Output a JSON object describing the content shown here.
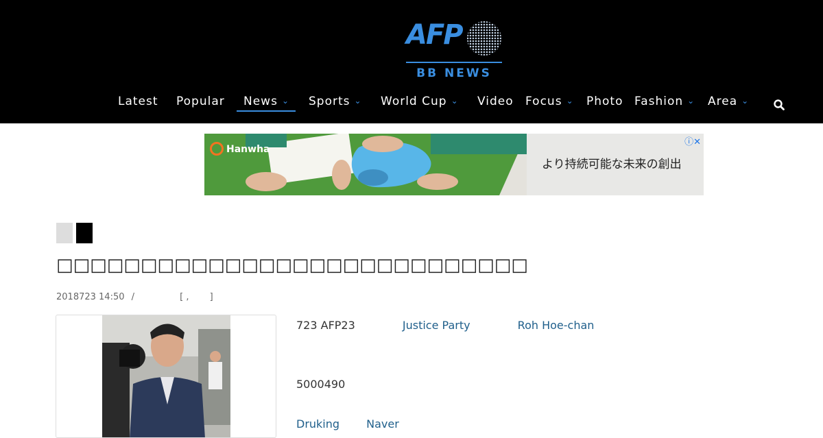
{
  "header": {
    "logo_text": "AFP",
    "logo_sub": "BB NEWS"
  },
  "nav": {
    "items": [
      {
        "label": "Latest",
        "has_dropdown": false
      },
      {
        "label": "Popular",
        "has_dropdown": false
      },
      {
        "label": "News",
        "has_dropdown": true,
        "active": true
      },
      {
        "label": "Sports",
        "has_dropdown": true
      },
      {
        "label": "World Cup",
        "has_dropdown": true
      },
      {
        "label": "Video",
        "has_dropdown": false
      },
      {
        "label": "Focus",
        "has_dropdown": true
      },
      {
        "label": "Photo",
        "has_dropdown": false
      },
      {
        "label": "Fashion",
        "has_dropdown": true
      },
      {
        "label": "Area",
        "has_dropdown": true
      }
    ],
    "chevron": "⌄",
    "search_icon": "search-icon"
  },
  "ad": {
    "brand": "Hanwha",
    "text": "より持続可能な未来の創出",
    "controls": "ⓘ✕"
  },
  "article": {
    "title": "□□□□□□□□□□□□□□□□□□□□□□□□□□□□",
    "date": "2018723 14:50",
    "separator": "/",
    "bracket_open": "[ ,",
    "bracket_close": "]",
    "line1_prefix": "723 AFP23",
    "link1": "Justice Party",
    "link2": "Roh Hoe-chan",
    "line2": "5000490",
    "link3": "Druking",
    "link4": "Naver"
  },
  "colors": {
    "header_bg": "#000000",
    "accent": "#3a8ee0",
    "link": "#1f5f8b"
  }
}
